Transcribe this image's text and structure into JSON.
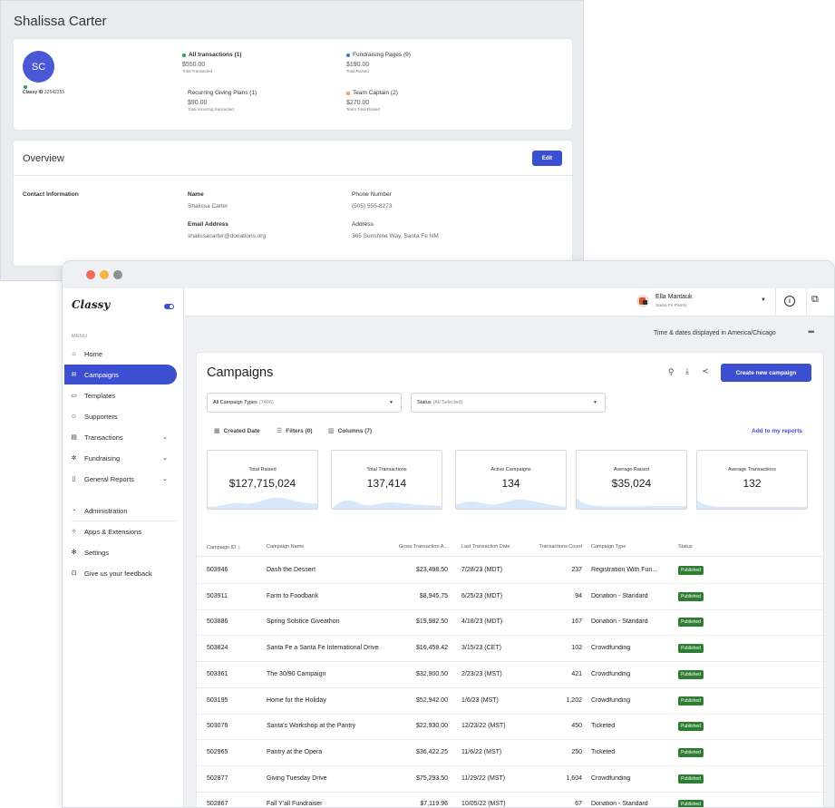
{
  "profile": {
    "name": "Shalissa Carter",
    "initials": "SC",
    "classy_id_label": "Classy ID",
    "classy_id": "32542255",
    "stats": [
      {
        "label": "All transactions (1)",
        "value": "$550.00",
        "sub": "Total Transacted",
        "dot": "#2e9d50"
      },
      {
        "label": "Fundraising Pages (9)",
        "value": "$190.00",
        "sub": "Total Raised",
        "dot": "#3d6fd6"
      },
      {
        "label": "Recurring Giving Plans (1)",
        "value": "$90.00",
        "sub": "Total recurring transacted",
        "dot": ""
      },
      {
        "label": "Team Captain (2)",
        "value": "$270.00",
        "sub": "Team Total Raised",
        "dot": "#f0a43a"
      }
    ],
    "overview_title": "Overview",
    "edit_label": "Edit",
    "contact_heading": "Contact Information",
    "fields": {
      "name_label": "Name",
      "name_value": "Shalissa Carter",
      "phone_label": "Phone Number",
      "phone_value": "(505) 555-8273",
      "email_label": "Email Address",
      "email_value": "shalissacarter@donations.org",
      "address_label": "Address",
      "address_value": "365 Sunshine Way, Santa Fe NM"
    }
  },
  "app": {
    "logo": "Classy",
    "menu_label": "MENU",
    "nav": [
      {
        "label": "Home",
        "icon": "home-icon",
        "glyph": "⌂",
        "chevron": false,
        "active": false
      },
      {
        "label": "Campaigns",
        "icon": "campaigns-icon",
        "glyph": "✉",
        "chevron": false,
        "active": true
      },
      {
        "label": "Templates",
        "icon": "templates-icon",
        "glyph": "▭",
        "chevron": false,
        "active": false
      },
      {
        "label": "Supporters",
        "icon": "supporters-icon",
        "glyph": "☺",
        "chevron": false,
        "active": false
      },
      {
        "label": "Transactions",
        "icon": "transactions-icon",
        "glyph": "▤",
        "chevron": true,
        "active": false
      },
      {
        "label": "Fundraising",
        "icon": "fundraising-icon",
        "glyph": "✲",
        "chevron": true,
        "active": false
      },
      {
        "label": "General Reports",
        "icon": "reports-icon",
        "glyph": "▯",
        "chevron": true,
        "active": false
      },
      {
        "label": "Administration",
        "icon": "administration-icon",
        "glyph": "◔",
        "chevron": false,
        "active": false
      },
      {
        "label": "Apps & Extensions",
        "icon": "apps-icon",
        "glyph": "✧",
        "chevron": false,
        "active": false
      },
      {
        "label": "Settings",
        "icon": "settings-icon",
        "glyph": "✻",
        "chevron": false,
        "active": false
      },
      {
        "label": "Give us your feedback",
        "icon": "feedback-icon",
        "glyph": "⊡",
        "chevron": false,
        "active": false
      }
    ],
    "user_name": "Ella Mantauk",
    "user_org": "Santa Fe Pantry",
    "timezone_note": "Time & dates displayed in America/Chicago",
    "more_glyph": "•••",
    "accent": "#3d4fd1"
  },
  "campaigns": {
    "title": "Campaigns",
    "create_label": "Create new campaign",
    "type_filter": {
      "label": "All Campaign Types",
      "count": "(7406)"
    },
    "status_filter": {
      "label": "Status",
      "count": "(All Selected)"
    },
    "tools": {
      "created_date": "Created Date",
      "filters": "Filters (0)",
      "columns": "Columns (7)"
    },
    "add_reports_label": "Add to my reports",
    "kpis": [
      {
        "label": "Total Raised",
        "value": "$127,715,024"
      },
      {
        "label": "Total Transactions",
        "value": "137,414"
      },
      {
        "label": "Active Campaigns",
        "value": "134"
      },
      {
        "label": "Average Raised",
        "value": "$35,024"
      },
      {
        "label": "Average Transactions",
        "value": "132"
      }
    ],
    "columns": [
      "Campaign ID",
      "Campaign Name",
      "Gross Transaction A...",
      "Last Transaction Date",
      "Transactions Count",
      "Campaign Type",
      "Status"
    ],
    "sort_glyph": "↓",
    "rows": [
      {
        "id": "503946",
        "name": "Dash the Dessert",
        "gross": "$23,498.50",
        "last": "7/28/23 (MDT)",
        "count": "237",
        "type": "Registration With Fun...",
        "status": "Published"
      },
      {
        "id": "503911",
        "name": "Farm to Foodbank",
        "gross": "$8,945.75",
        "last": "6/25/23 (MDT)",
        "count": "94",
        "type": "Donation - Standard",
        "status": "Published"
      },
      {
        "id": "503886",
        "name": "Spring Solstice Giveathon",
        "gross": "$19,982.50",
        "last": "4/18/23 (MDT)",
        "count": "167",
        "type": "Donation - Standard",
        "status": "Published"
      },
      {
        "id": "503824",
        "name": "Santa Fe a Santa Fe International Drive",
        "gross": "$16,459.42",
        "last": "3/15/23 (CET)",
        "count": "102",
        "type": "Crowdfunding",
        "status": "Published"
      },
      {
        "id": "503361",
        "name": "The 30/90 Campaign",
        "gross": "$32,900.50",
        "last": "2/23/23 (MST)",
        "count": "421",
        "type": "Crowdfunding",
        "status": "Published"
      },
      {
        "id": "503195",
        "name": "Home for the Holiday",
        "gross": "$52,942.00",
        "last": "1/6/23 (MST)",
        "count": "1,202",
        "type": "Crowdfunding",
        "status": "Published"
      },
      {
        "id": "503076",
        "name": "Santa's Workshop at the Pantry",
        "gross": "$22,930.00",
        "last": "12/23/22 (MST)",
        "count": "450",
        "type": "Ticketed",
        "status": "Published"
      },
      {
        "id": "502965",
        "name": "Pantry at the Opera",
        "gross": "$36,422.25",
        "last": "11/6/22 (MST)",
        "count": "250",
        "type": "Ticketed",
        "status": "Published"
      },
      {
        "id": "502877",
        "name": "Giving Tuesday Drive",
        "gross": "$75,293.50",
        "last": "11/29/22 (MST)",
        "count": "1,604",
        "type": "Crowdfunding",
        "status": "Published"
      },
      {
        "id": "502867",
        "name": "Fall Y'all Fundraiser",
        "gross": "$7,119.96",
        "last": "10/05/22 (MST)",
        "count": "67",
        "type": "Donation - Standard",
        "status": "Published"
      }
    ]
  }
}
